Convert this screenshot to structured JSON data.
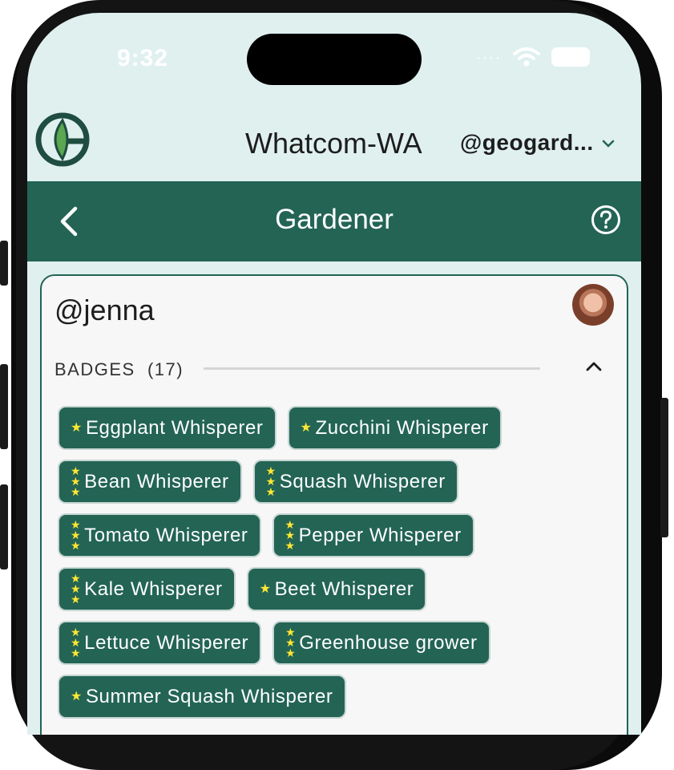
{
  "status_bar": {
    "time": "9:32"
  },
  "header": {
    "region": "Whatcom-WA",
    "account": "@geogard..."
  },
  "navbar": {
    "title": "Gardener"
  },
  "profile": {
    "username": "@jenna",
    "badges_label": "BADGES",
    "badges_count": "(17)",
    "badges": [
      {
        "label": "Eggplant Whisperer",
        "stars": 1
      },
      {
        "label": "Zucchini Whisperer",
        "stars": 1
      },
      {
        "label": "Bean Whisperer",
        "stars": 3
      },
      {
        "label": "Squash Whisperer",
        "stars": 3
      },
      {
        "label": "Tomato Whisperer",
        "stars": 3
      },
      {
        "label": "Pepper Whisperer",
        "stars": 3
      },
      {
        "label": "Kale Whisperer",
        "stars": 3
      },
      {
        "label": "Beet Whisperer",
        "stars": 1
      },
      {
        "label": "Lettuce Whisperer",
        "stars": 3
      },
      {
        "label": "Greenhouse grower",
        "stars": 3
      },
      {
        "label": "Summer Squash Whisperer",
        "stars": 1
      }
    ]
  },
  "colors": {
    "primary": "#236455",
    "background": "#dff0ef",
    "star": "#ffe733",
    "card": "#f7f7f7"
  }
}
